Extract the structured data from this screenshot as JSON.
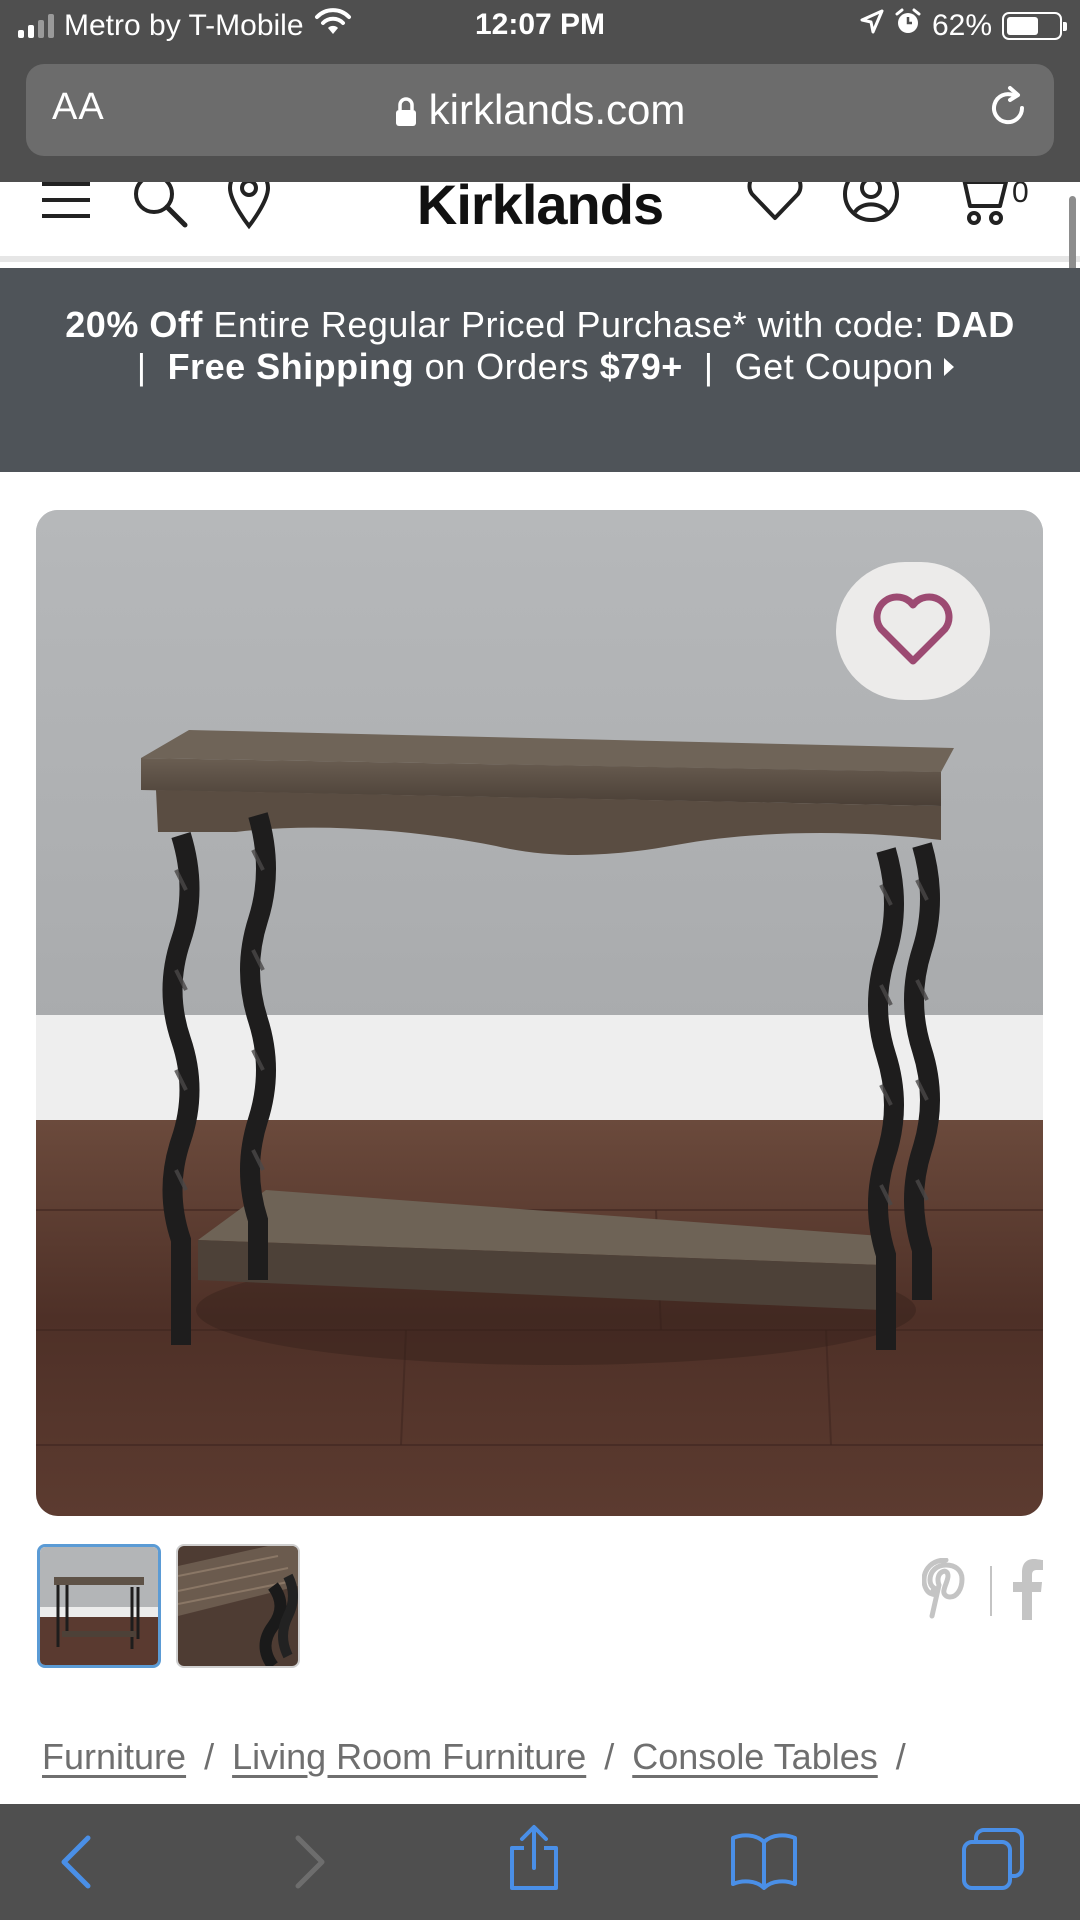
{
  "status_bar": {
    "carrier": "Metro by T-Mobile",
    "time": "12:07 PM",
    "battery": "62%",
    "battery_level": 0.62
  },
  "browser": {
    "text_size_button": "AA",
    "url": "kirklands.com"
  },
  "header": {
    "logo": "Kirklands",
    "cart_count": "0"
  },
  "promo": {
    "discount": "20% Off",
    "discount_text": "Entire Regular Priced Purchase* with code:",
    "code": "DAD",
    "divider": "|",
    "shipping": "Free Shipping",
    "shipping_text": "on Orders",
    "threshold": "$79+",
    "coupon_link": "Get Coupon"
  },
  "breadcrumb": {
    "items": [
      "Furniture",
      "Living Room Furniture",
      "Console Tables"
    ],
    "separator": "/"
  },
  "colors": {
    "chrome": "#4f4f4f",
    "promo_bg": "#4f5459",
    "wishlist_heart": "#9c4a72",
    "toolbar_active": "#4a8fe7",
    "toolbar_disabled": "#6d6d6d",
    "thumb_selected": "#5b9bd5"
  },
  "icons": {
    "status": [
      "signal-icon",
      "wifi-icon",
      "location-arrow-icon",
      "alarm-icon",
      "battery-icon"
    ],
    "header": [
      "menu-icon",
      "search-icon",
      "store-locator-icon",
      "wishlist-icon",
      "account-icon",
      "cart-icon"
    ],
    "toolbar": [
      "back-icon",
      "forward-icon",
      "share-icon",
      "bookmarks-icon",
      "tabs-icon"
    ],
    "social": [
      "pinterest-icon",
      "facebook-icon"
    ]
  }
}
